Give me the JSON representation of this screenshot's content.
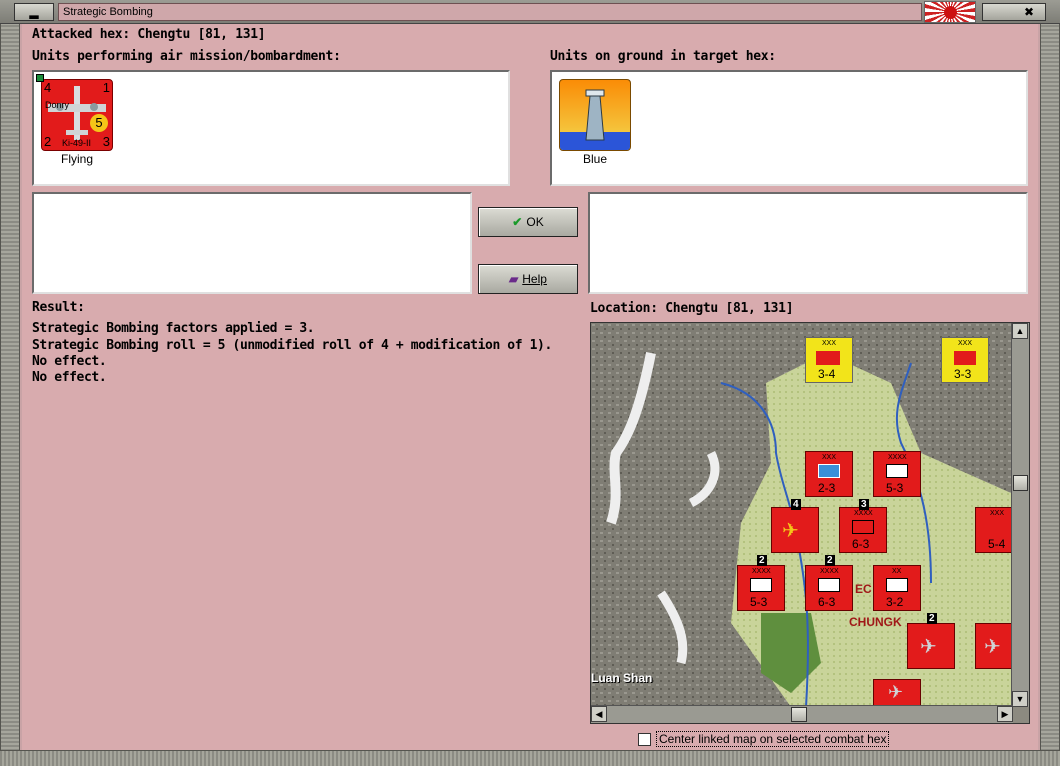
{
  "window": {
    "title": "Strategic Bombing",
    "minimize_glyph": "▂",
    "close_glyph": "✖"
  },
  "attacked_hex": "Attacked hex: Chengtu  [81, 131]",
  "air_units": {
    "header": "Units performing air mission/bombardment:",
    "items": [
      {
        "caption": "Flying",
        "name": "Donry",
        "model": "Ki-49-II",
        "attack": "4",
        "range": "1",
        "defense": "2",
        "move": "3",
        "strength": "5",
        "icon": "bomber-plane-icon"
      }
    ]
  },
  "ground_units": {
    "header": "Units on ground in target hex:",
    "items": [
      {
        "caption": "Blue",
        "icon": "factory-chimney-icon"
      }
    ]
  },
  "buttons": {
    "ok_label": "OK",
    "ok_icon": "checkmark-icon",
    "help_label": "Help",
    "help_icon": "book-icon"
  },
  "result": {
    "header": "Result:",
    "lines": [
      "Strategic Bombing factors applied = 3.",
      "Strategic Bombing roll = 5 (unmodified roll of 4 + modification of 1).",
      "No effect.",
      "No effect."
    ]
  },
  "location": {
    "header": "Location:  Chengtu  [81, 131]"
  },
  "map": {
    "place_labels": [
      "Luan Shan",
      "CHUNGK",
      "EC"
    ],
    "counters": [
      {
        "strength": "3-4",
        "size": "XXX",
        "color": "#f2e41a"
      },
      {
        "strength": "3-3",
        "size": "XXX",
        "color": "#f2e41a"
      },
      {
        "strength": "2-3",
        "size": "XXX",
        "color": "#e21b1b"
      },
      {
        "strength": "5-3",
        "size": "XXXX",
        "color": "#e21b1b"
      },
      {
        "strength": "6-3",
        "size": "XXXX",
        "color": "#e21b1b"
      },
      {
        "strength": "5-4",
        "size": "XXX",
        "color": "#e21b1b"
      },
      {
        "strength": "5-3",
        "size": "XXXX",
        "color": "#e21b1b"
      },
      {
        "strength": "6-3",
        "size": "XXXX",
        "color": "#e21b1b"
      },
      {
        "strength": "3-2",
        "size": "XX",
        "color": "#e21b1b"
      }
    ],
    "stack_badges": [
      "4",
      "3",
      "2",
      "2",
      "2"
    ]
  },
  "center_map_checkbox": {
    "label": "Center linked map on selected combat hex",
    "checked": false
  }
}
